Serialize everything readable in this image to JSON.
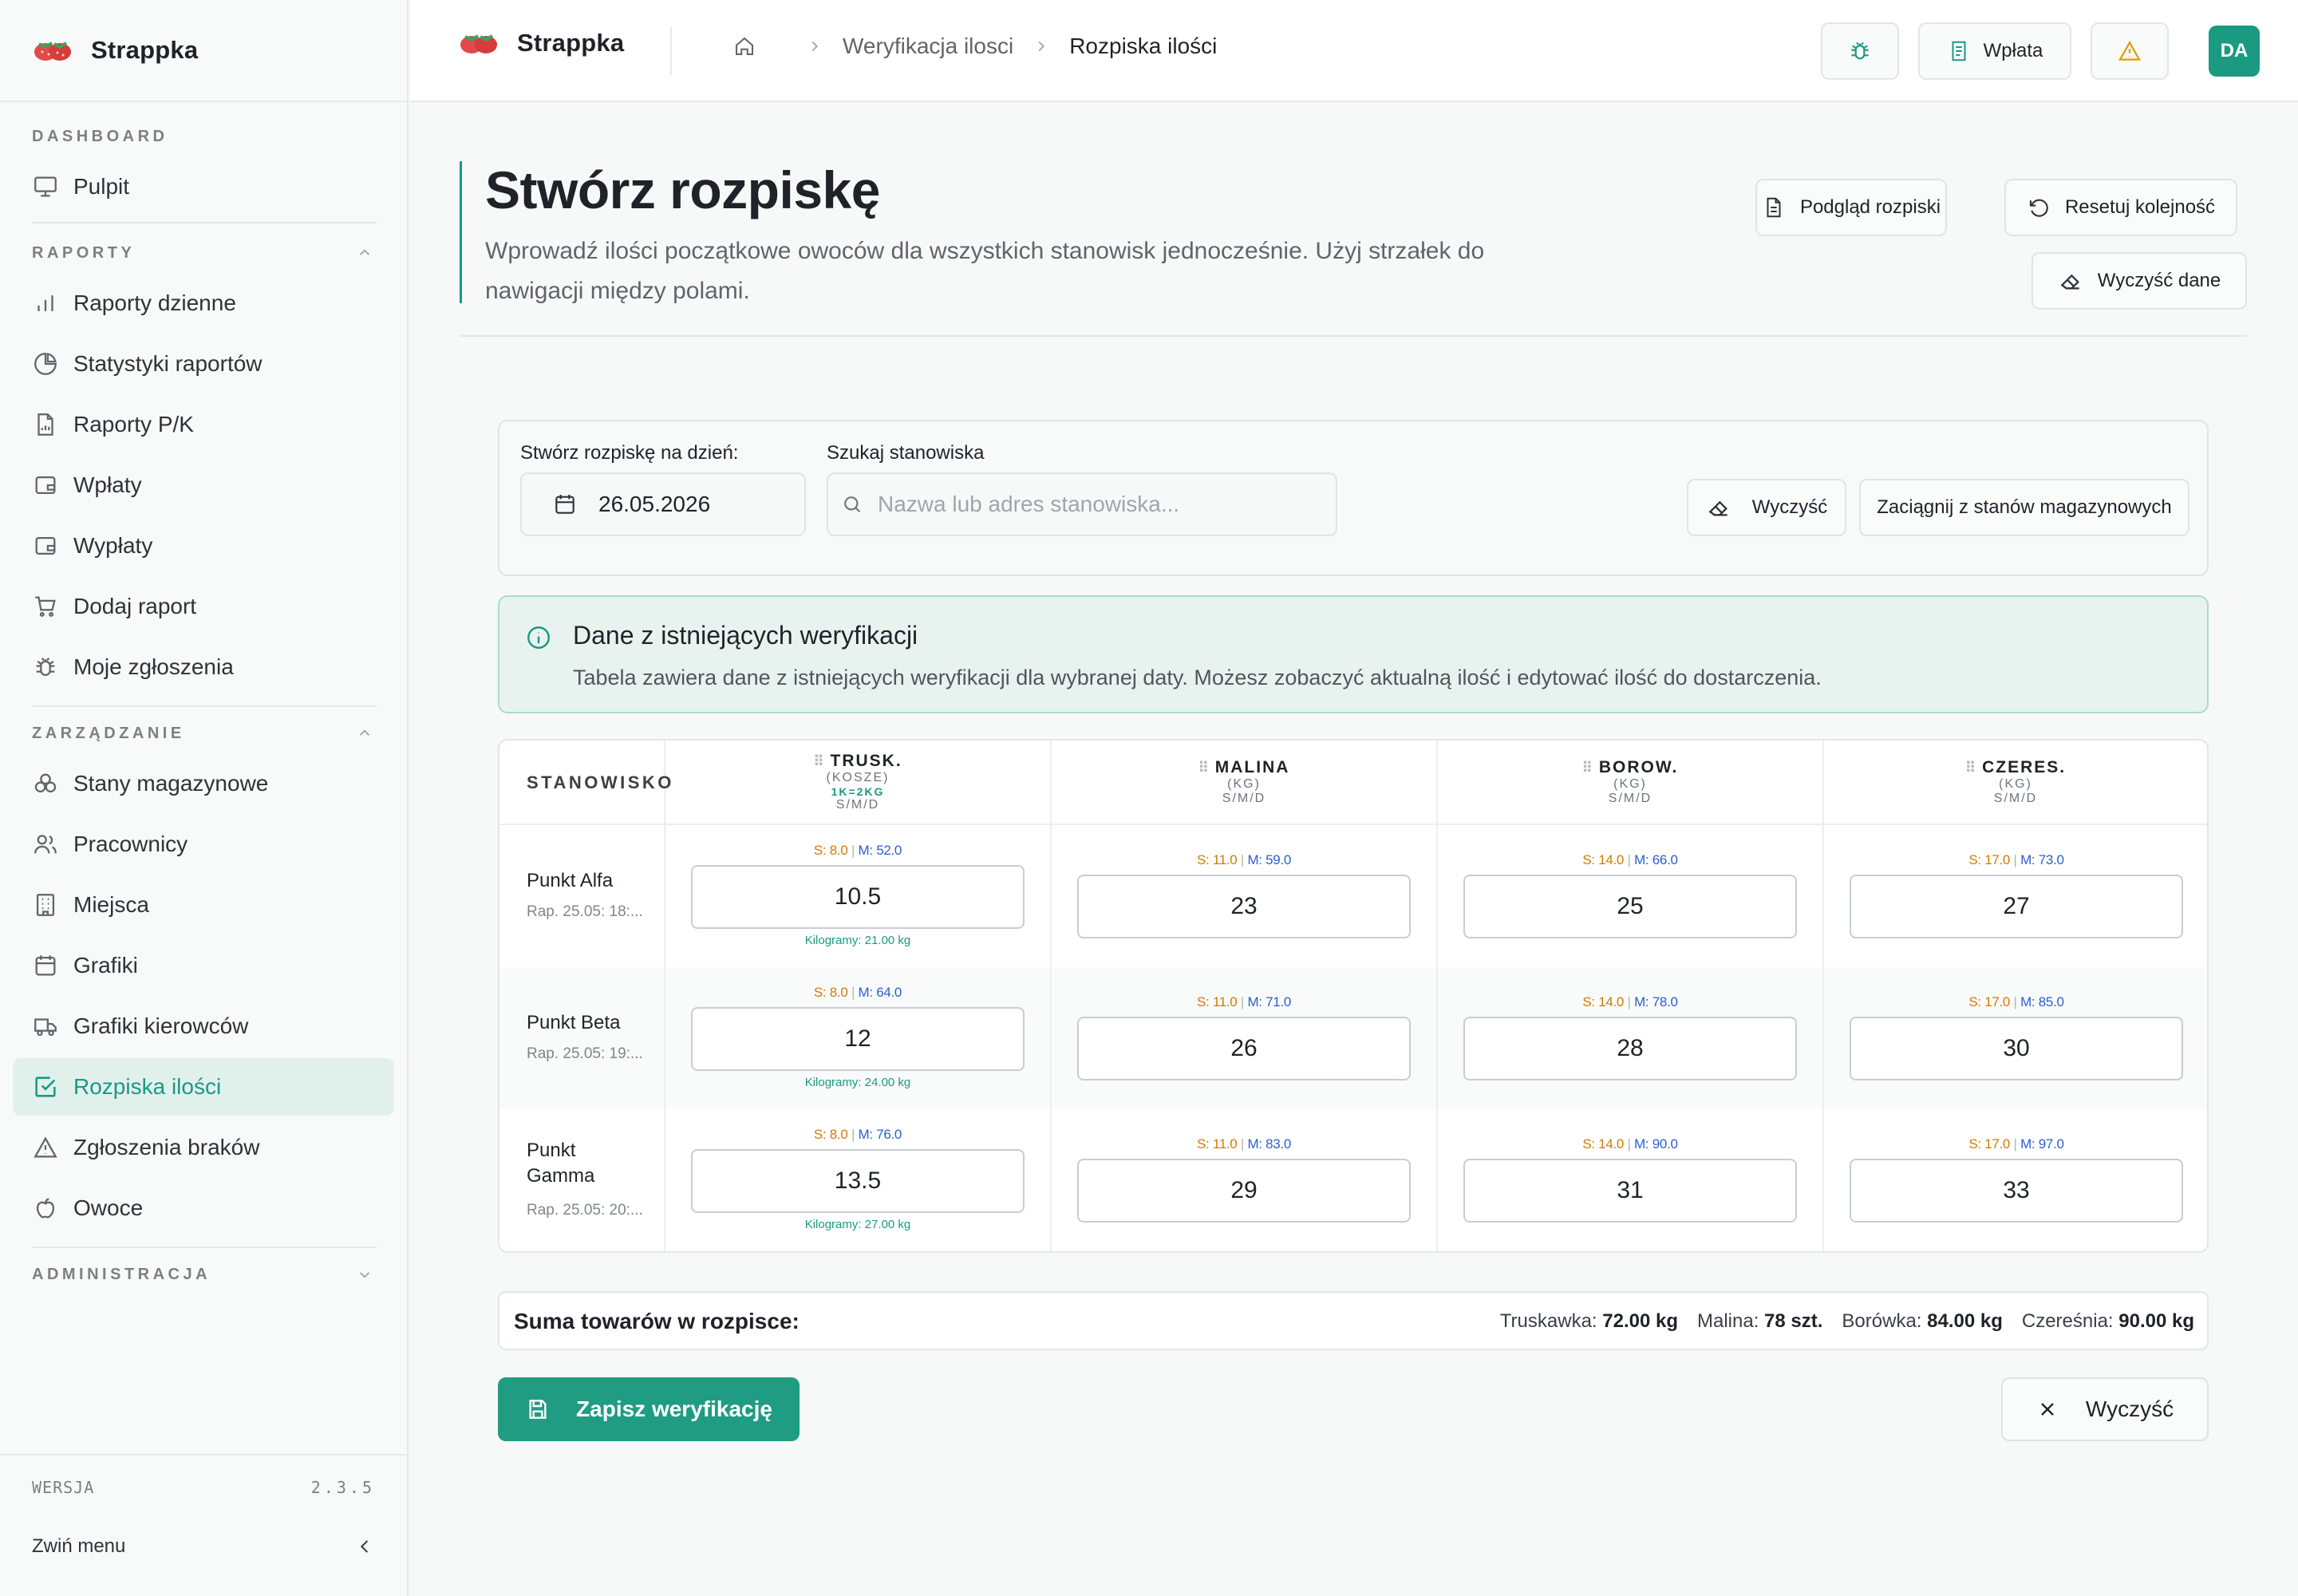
{
  "brand": {
    "name": "Strappka"
  },
  "sidebar": {
    "sections": {
      "dashboard": "DASHBOARD",
      "reports": "RAPORTY",
      "management": "ZARZĄDZANIE",
      "admin": "ADMINISTRACJA"
    },
    "items": {
      "pulpit": "Pulpit",
      "daily_reports": "Raporty dzienne",
      "report_stats": "Statystyki raportów",
      "pk_reports": "Raporty P/K",
      "deposits": "Wpłaty",
      "withdrawals": "Wypłaty",
      "add_report": "Dodaj raport",
      "my_tickets": "Moje zgłoszenia",
      "stock": "Stany magazynowe",
      "workers": "Pracownicy",
      "places": "Miejsca",
      "schedules": "Grafiki",
      "driver_schedules": "Grafiki kierowców",
      "quantity_breakdown": "Rozpiska ilości",
      "shortage_reports": "Zgłoszenia braków",
      "fruits": "Owoce"
    },
    "version_label": "WERSJA",
    "version": "2.3.5",
    "collapse_label": "Zwiń menu"
  },
  "topbar": {
    "breadcrumb_1": "Weryfikacja ilosci",
    "breadcrumb_2": "Rozpiska ilości",
    "payment_label": "Wpłata",
    "avatar_initials": "DA"
  },
  "header": {
    "title": "Stwórz rozpiskę",
    "description": "Wprowadź ilości początkowe owoców dla wszystkich stanowisk jednocześnie. Użyj strzałek do nawigacji między polami.",
    "preview_label": "Podgląd rozpiski",
    "reset_label": "Resetuj kolejność",
    "clear_data_label": "Wyczyść dane"
  },
  "filters": {
    "date_label": "Stwórz rozpiskę na dzień:",
    "date_value": "26.05.2026",
    "search_label": "Szukaj stanowiska",
    "search_placeholder": "Nazwa lub adres stanowiska...",
    "clear_label": "Wyczyść",
    "pull_label": "Zaciągnij z stanów magazynowych"
  },
  "info": {
    "title": "Dane z istniejących weryfikacji",
    "text": "Tabela zawiera dane z istniejących weryfikacji dla wybranej daty. Możesz zobaczyć aktualną ilość i edytować ilość do dostarczenia."
  },
  "table": {
    "station_header": "STANOWISKO",
    "columns": [
      {
        "name": "TRUSK.",
        "unit": "(KOSZE)",
        "conversion": "1K=2KG",
        "smd": "S/M/D"
      },
      {
        "name": "MALINA",
        "unit": "(KG)",
        "conversion": "",
        "smd": "S/M/D"
      },
      {
        "name": "BOROW.",
        "unit": "(KG)",
        "conversion": "",
        "smd": "S/M/D"
      },
      {
        "name": "CZERES.",
        "unit": "(KG)",
        "conversion": "",
        "smd": "S/M/D"
      }
    ],
    "rows": [
      {
        "name": "Punkt Alfa",
        "sub": "Rap. 25.05: 18:...",
        "cells": [
          {
            "s": "S: 8.0",
            "m": "M: 52.0",
            "value": "10.5",
            "kg": "Kilogramy: 21.00 kg"
          },
          {
            "s": "S: 11.0",
            "m": "M: 59.0",
            "value": "23",
            "kg": ""
          },
          {
            "s": "S: 14.0",
            "m": "M: 66.0",
            "value": "25",
            "kg": ""
          },
          {
            "s": "S: 17.0",
            "m": "M: 73.0",
            "value": "27",
            "kg": ""
          }
        ]
      },
      {
        "name": "Punkt Beta",
        "sub": "Rap. 25.05: 19:...",
        "cells": [
          {
            "s": "S: 8.0",
            "m": "M: 64.0",
            "value": "12",
            "kg": "Kilogramy: 24.00 kg"
          },
          {
            "s": "S: 11.0",
            "m": "M: 71.0",
            "value": "26",
            "kg": ""
          },
          {
            "s": "S: 14.0",
            "m": "M: 78.0",
            "value": "28",
            "kg": ""
          },
          {
            "s": "S: 17.0",
            "m": "M: 85.0",
            "value": "30",
            "kg": ""
          }
        ]
      },
      {
        "name": "Punkt Gamma",
        "sub": "Rap. 25.05: 20:...",
        "cells": [
          {
            "s": "S: 8.0",
            "m": "M: 76.0",
            "value": "13.5",
            "kg": "Kilogramy: 27.00 kg"
          },
          {
            "s": "S: 11.0",
            "m": "M: 83.0",
            "value": "29",
            "kg": ""
          },
          {
            "s": "S: 14.0",
            "m": "M: 90.0",
            "value": "31",
            "kg": ""
          },
          {
            "s": "S: 17.0",
            "m": "M: 97.0",
            "value": "33",
            "kg": ""
          }
        ]
      }
    ]
  },
  "summary": {
    "label": "Suma towarów w rozpisce:",
    "items": [
      {
        "name": "Truskawka:",
        "value": "72.00 kg"
      },
      {
        "name": "Malina:",
        "value": "78 szt."
      },
      {
        "name": "Borówka:",
        "value": "84.00 kg"
      },
      {
        "name": "Czereśnia:",
        "value": "90.00 kg"
      }
    ]
  },
  "actions": {
    "save_label": "Zapisz weryfikację",
    "clear_label": "Wyczyść"
  },
  "colors": {
    "accent": "#1a9a80",
    "warning": "#e0a000",
    "stat_s": "#d37a00",
    "stat_m": "#2b5fd0"
  }
}
